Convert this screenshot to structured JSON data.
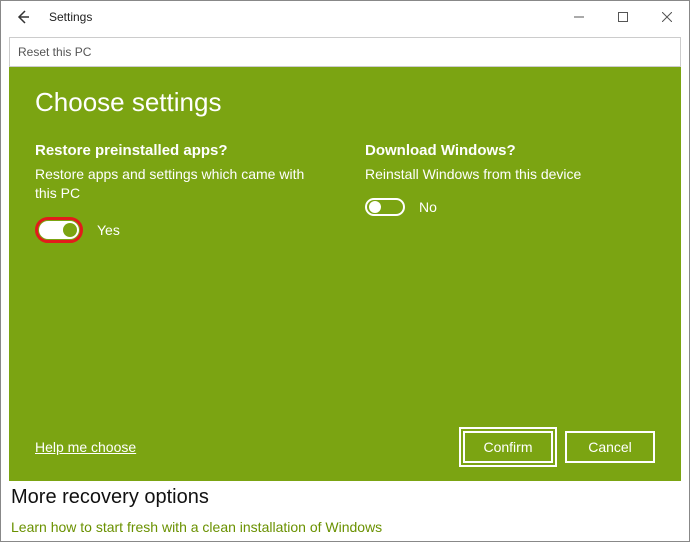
{
  "window": {
    "title": "Settings",
    "breadcrumb": "Reset this PC"
  },
  "panel": {
    "heading": "Choose settings",
    "options": {
      "restore": {
        "title": "Restore preinstalled apps?",
        "desc": "Restore apps and settings which came with this PC",
        "value_label": "Yes"
      },
      "download": {
        "title": "Download Windows?",
        "desc": "Reinstall Windows from this device",
        "value_label": "No"
      }
    },
    "help_link": "Help me choose",
    "buttons": {
      "confirm": "Confirm",
      "cancel": "Cancel"
    }
  },
  "below": {
    "heading": "More recovery options",
    "link": "Learn how to start fresh with a clean installation of Windows"
  }
}
